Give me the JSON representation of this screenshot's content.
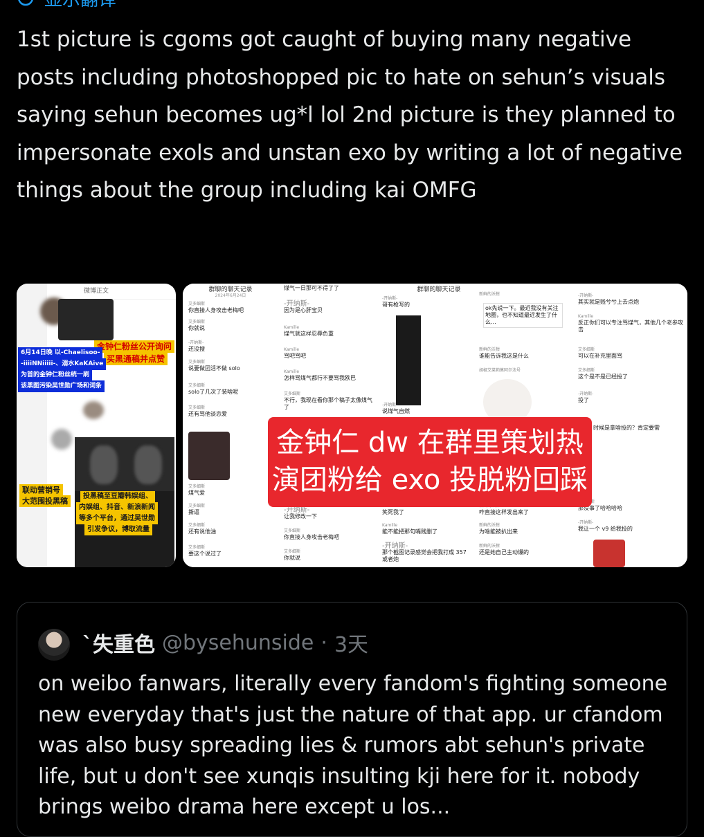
{
  "translate": {
    "label": "显示翻译"
  },
  "tweet": {
    "text": "1st picture is cgoms got caught of buying many negative posts including photoshopped pic to hate on sehun’s visuals saying sehun becomes ug*l lol 2nd picture is they planned to impersonate exols and unstan exo by writing a lot of negative things about the group including kai OMFG"
  },
  "media": {
    "image1": {
      "header": "微博正文",
      "tag_yellow_1": "金钟仁粉丝公开询问",
      "tag_yellow_2": "买黑通稿并点赞",
      "tag_blue_1": "6月14日晚 以-Chaelisoo-",
      "tag_blue_2": "-iiiiNNiiiii-、溺水KaKAive",
      "tag_blue_3": "为首的金钟仁粉丝统一刷",
      "tag_blue_4": "该黑图污染吴世勋广场和词条",
      "tag_yellow_3": "联动营销号",
      "tag_yellow_4": "大范围投黑稿",
      "tag_yellow_5": "投黑稿至豆瓣韩娱组、",
      "tag_yellow_6": "内娱组、抖音、新浪新闻",
      "tag_yellow_7": "等多个平台，通过吴世勋",
      "tag_yellow_8": "引发争议，博取流量"
    },
    "image2": {
      "chat_title": "群聊的聊天记录",
      "chat_date": "2024年6月24日",
      "overlay_line_1": "金钟仁 dw 在群里策划热",
      "overlay_line_2": "演团粉给 exo 投脱粉回踩",
      "col1": [
        "你直接人身攻击老梅吧",
        "你就说",
        "还没搜",
        "说要做团活不做 solo",
        "solo了几次了装啥呢",
        "还有骂他谈恋爱",
        "煤气爱",
        "撕逼",
        "还有说他油",
        "要这个说过了"
      ],
      "col2": [
        "煤气一日那可不得了了",
        "因为是心肝宝贝",
        "煤气就这样忍辱负重",
        "骂吧骂吧",
        "怎样骂煤气都行不要骂我欧巴",
        "不行，我现在看你那个稿子太像煤气了",
        "让我修改一下",
        "你直接人身攻击老梅吧",
        "你就说"
      ],
      "col3": [
        "哥有枪写的",
        "说煤气自燃",
        "笑死我了",
        "能不能把那句嘴贱删了",
        "那个截图记录感觉会把我打成 357 或者炮"
      ],
      "col4": [
        "ok先说一下。最近我没有关注地圈，也不知道最近发生了什么...",
        "谁能告诉我这是什么",
        "咋直接这样发出来了",
        "为啥能被扒出来",
        "还是她自己主动爆的"
      ],
      "col5": [
        "其实就是贱兮兮上去点炮",
        "反正你们可以专注骂煤气，其他几个老参攻击",
        "可以在补充里面骂",
        "这个是不是已经投了",
        "投了",
        "时候是拿啥投的？肯定要需",
        "那没事了哈哈哈哈",
        "我让一个 v9 给我投的"
      ],
      "names": {
        "a": "艾多细斯",
        "b": "-开纳斯-",
        "c": "Kamille",
        "d": "新鲜的沃柑",
        "e": "胡椒艾菜莉莫阿尔法号"
      }
    }
  },
  "quote": {
    "name": "`失重色",
    "handle": "@bysehunside",
    "dot": "·",
    "time": "3天",
    "text": "on weibo fanwars, literally every fandom's fighting someone new everyday that's just the nature of that app. ur cfandom was also busy spreading lies & rumors abt sehun's private life, but u don't see xunqis insulting kji here for it. nobody brings weibo drama here except u los..."
  },
  "colors": {
    "background": "#000000",
    "text": "#e7e9ea",
    "muted": "#71767b",
    "link": "#1d9bf0",
    "overlay_red": "#e8272d",
    "tag_yellow": "#f5c400",
    "tag_blue": "#0d2dd9"
  },
  "icons": {
    "translate": "translate-icon"
  }
}
